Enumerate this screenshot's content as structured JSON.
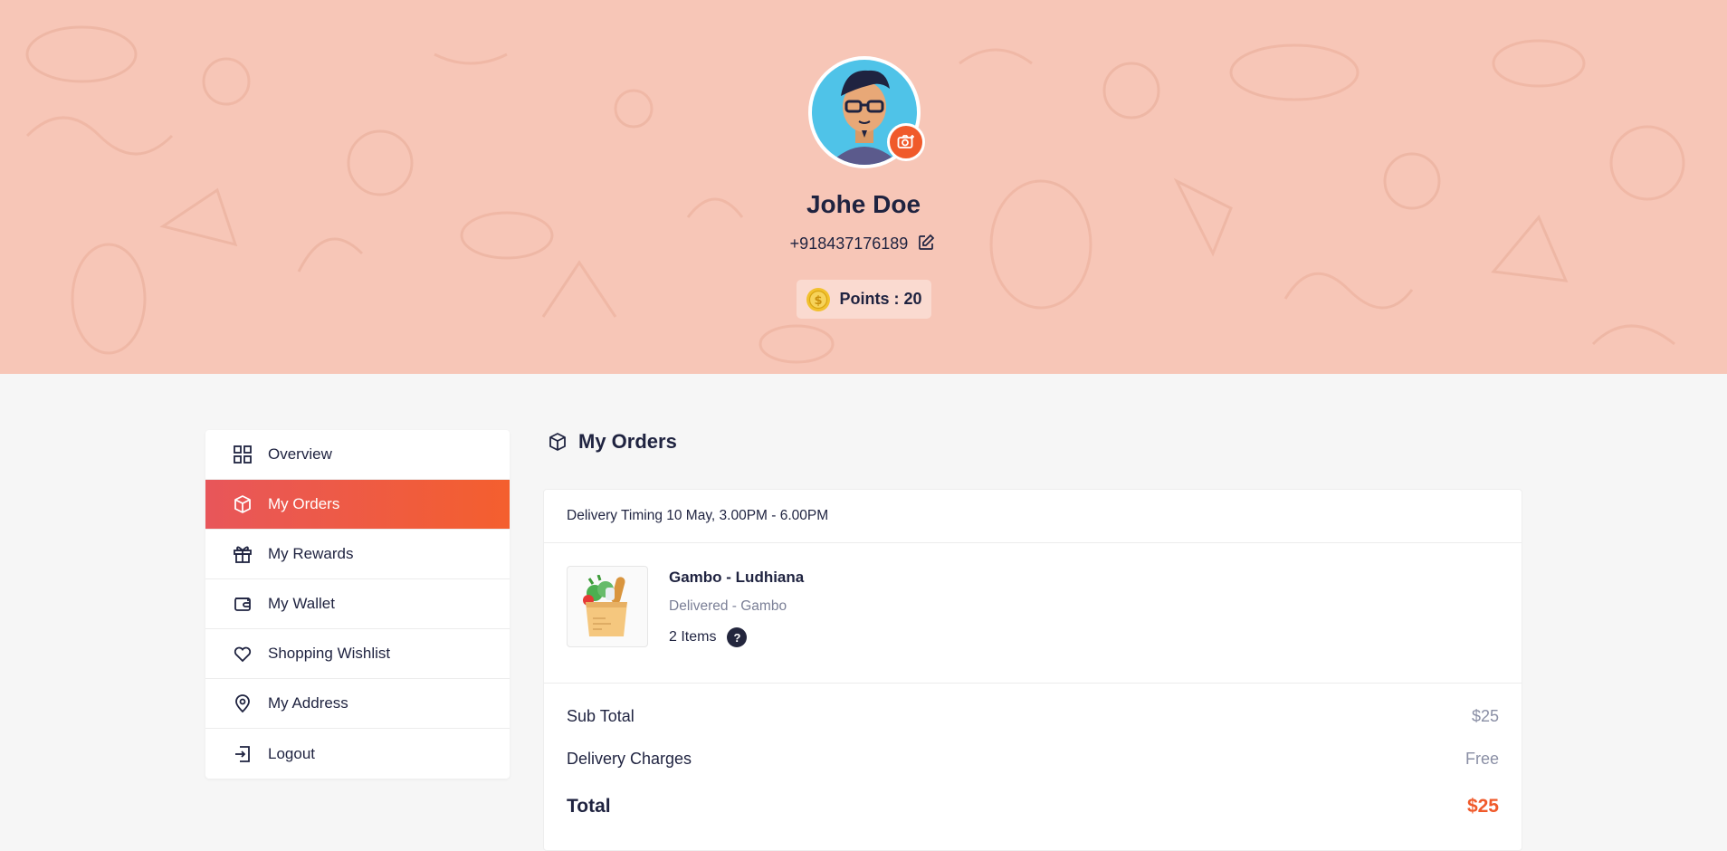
{
  "profile": {
    "name": "Johe Doe",
    "phone": "+918437176189",
    "points_label": "Points : 20"
  },
  "sidebar": {
    "items": [
      {
        "label": "Overview",
        "icon": "grid-icon",
        "active": false
      },
      {
        "label": "My Orders",
        "icon": "box-icon",
        "active": true
      },
      {
        "label": "My Rewards",
        "icon": "gift-icon",
        "active": false
      },
      {
        "label": "My Wallet",
        "icon": "wallet-icon",
        "active": false
      },
      {
        "label": "Shopping Wishlist",
        "icon": "heart-icon",
        "active": false
      },
      {
        "label": "My Address",
        "icon": "map-pin-icon",
        "active": false
      },
      {
        "label": "Logout",
        "icon": "logout-icon",
        "active": false
      }
    ]
  },
  "orders": {
    "title": "My Orders",
    "delivery_timing": "Delivery Timing 10 May, 3.00PM - 6.00PM",
    "store_name": "Gambo - Ludhiana",
    "status": "Delivered - Gambo",
    "items_count": "2 Items",
    "help_icon_text": "?",
    "sub_total_label": "Sub Total",
    "sub_total_value": "$25",
    "delivery_label": "Delivery Charges",
    "delivery_value": "Free",
    "total_label": "Total",
    "total_value": "$25"
  },
  "colors": {
    "hero_bg": "#f7c6b7",
    "accent": "#f05a2b",
    "active_gradient_start": "#e8565a",
    "active_gradient_end": "#f45f2e",
    "text_dark": "#1f2340"
  }
}
